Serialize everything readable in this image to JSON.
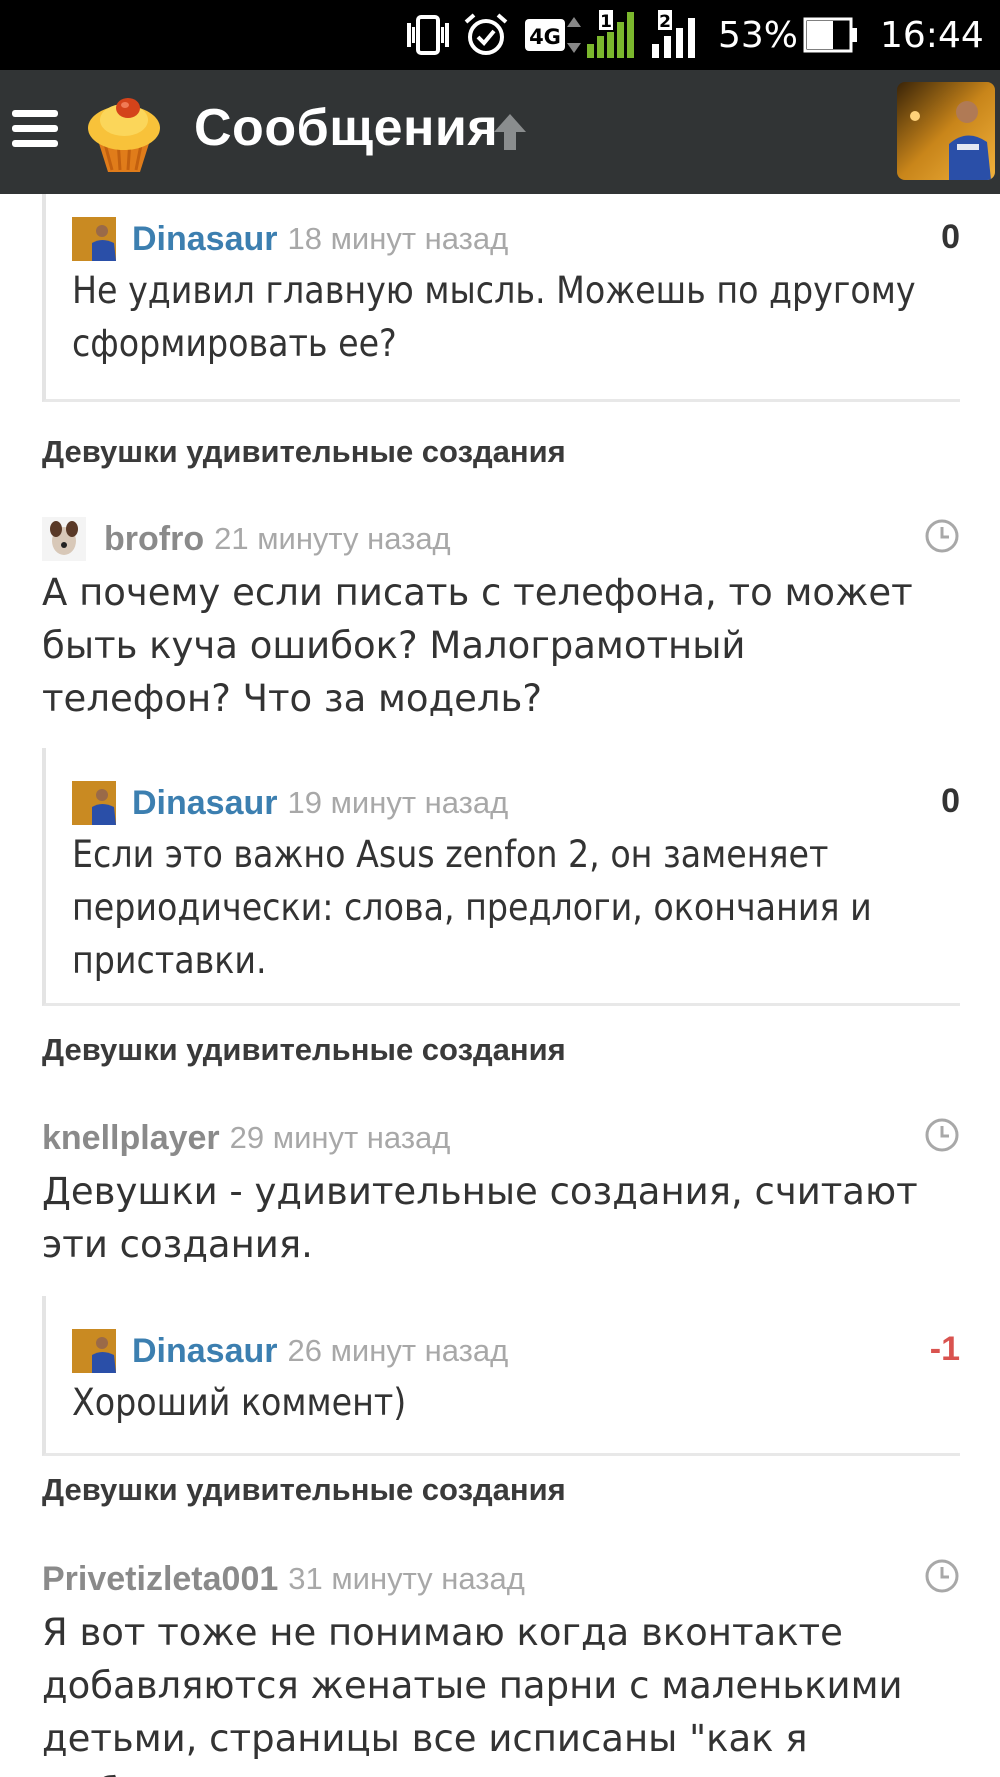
{
  "status_bar": {
    "battery_percent": "53%",
    "time": "16:44",
    "network": "4G",
    "sim1": "1",
    "sim2": "2"
  },
  "app_bar": {
    "title": "Сообщения"
  },
  "threads": [
    {
      "post_title": null,
      "comment": null,
      "reply": {
        "author": "Dinasaur",
        "time": "18 минут назад",
        "score": "0",
        "text": "Не удивил главную мысль. Можешь по другому сформировать ее?"
      }
    },
    {
      "post_title": "Девушки удивительные создания",
      "comment": {
        "author": "brofro",
        "time": "21 минуту назад",
        "text": "А почему если писать с телефона, то может быть куча ошибок? Малограмотный телефон? Что за модель?"
      },
      "reply": {
        "author": "Dinasaur",
        "time": "19 минут назад",
        "score": "0",
        "text": "Если это важно Asus zenfon 2, он заменяет периодически: слова, предлоги, окончания и приставки."
      }
    },
    {
      "post_title": "Девушки удивительные создания",
      "comment": {
        "author": "knellplayer",
        "time": "29 минут назад",
        "text": "Девушки - удивительные создания, считают эти создания."
      },
      "reply": {
        "author": "Dinasaur",
        "time": "26 минут назад",
        "score": "-1",
        "text": "Хороший коммент)"
      }
    },
    {
      "post_title": "Девушки удивительные создания",
      "comment": {
        "author": "Privetizleta001",
        "time": "31 минуту назад",
        "text": "Я вот тоже не понимаю когда вконтакте добавляются женатые парни с маленькими детьми, страницы все исписаны \"как я люблю"
      },
      "reply": null
    }
  ],
  "colors": {
    "app_bar": "#313435",
    "author_self": "#3c7fb0",
    "negative_score": "#d9534f"
  }
}
